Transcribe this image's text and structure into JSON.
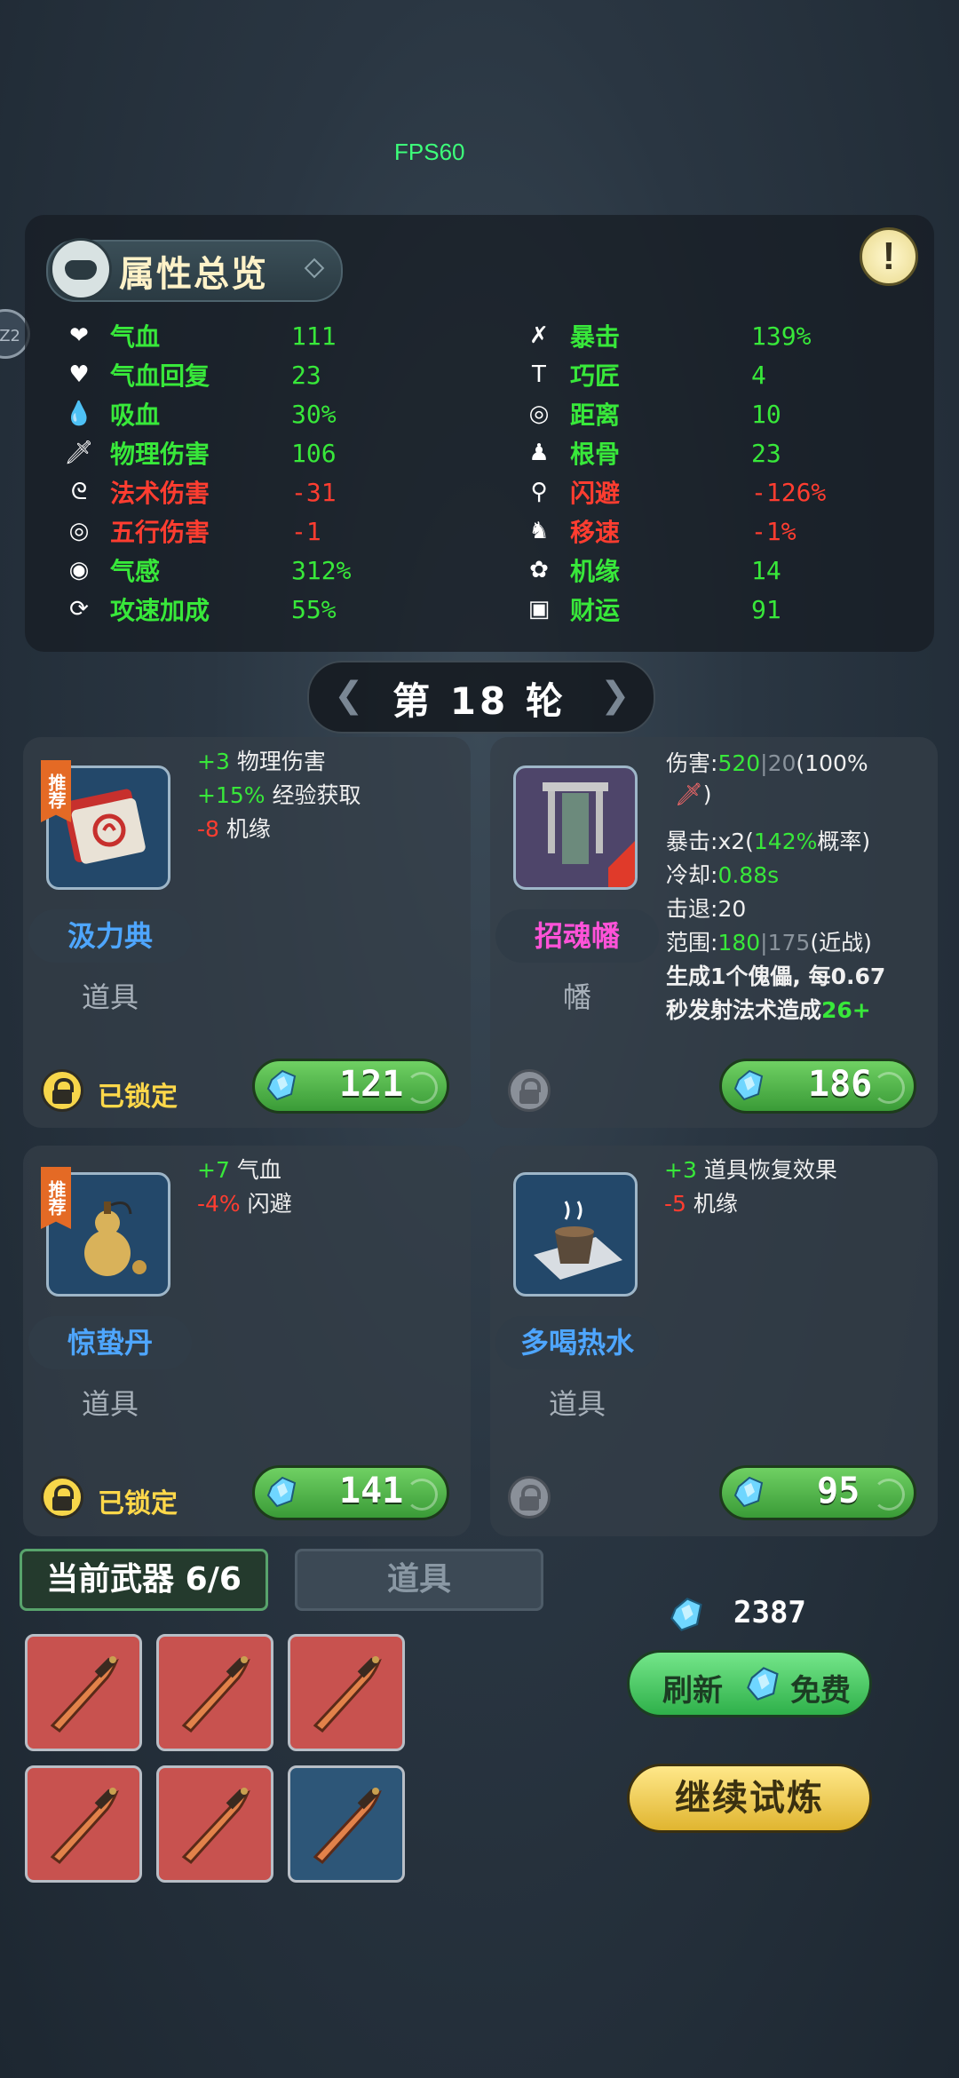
{
  "fps": "FPS60",
  "side_bubble": "Z2",
  "stats_panel": {
    "title": "属性总览",
    "alert_symbol": "!",
    "left": [
      {
        "icon": "heart-icon",
        "name": "气血",
        "value": "111",
        "color": "green"
      },
      {
        "icon": "heart-regen-icon",
        "name": "气血回复",
        "value": "23",
        "color": "green"
      },
      {
        "icon": "drop-icon",
        "name": "吸血",
        "value": "30%",
        "color": "green"
      },
      {
        "icon": "sword-icon",
        "name": "物理伤害",
        "value": "106",
        "color": "green"
      },
      {
        "icon": "spiral-icon",
        "name": "法术伤害",
        "value": "-31",
        "color": "red"
      },
      {
        "icon": "spiral-circle-icon",
        "name": "五行伤害",
        "value": "-1",
        "color": "red"
      },
      {
        "icon": "qi-icon",
        "name": "气感",
        "value": "312%",
        "color": "green"
      },
      {
        "icon": "attack-speed-icon",
        "name": "攻速加成",
        "value": "55%",
        "color": "green"
      }
    ],
    "right": [
      {
        "icon": "crit-icon",
        "name": "暴击",
        "value": "139%",
        "color": "green"
      },
      {
        "icon": "hammer-icon",
        "name": "巧匠",
        "value": "4",
        "color": "green"
      },
      {
        "icon": "target-icon",
        "name": "距离",
        "value": "10",
        "color": "green"
      },
      {
        "icon": "body-icon",
        "name": "根骨",
        "value": "23",
        "color": "green"
      },
      {
        "icon": "dodge-icon",
        "name": "闪避",
        "value": "-126%",
        "color": "red"
      },
      {
        "icon": "boot-icon",
        "name": "移速",
        "value": "-1%",
        "color": "red"
      },
      {
        "icon": "luck-icon",
        "name": "机缘",
        "value": "14",
        "color": "green"
      },
      {
        "icon": "coin-icon",
        "name": "财运",
        "value": "91",
        "color": "green"
      }
    ]
  },
  "round_label": "第 18 轮",
  "cards": [
    {
      "recommended": "推荐",
      "name": "汲力典",
      "type": "道具",
      "attrs": [
        {
          "prefix": "+3",
          "prefix_color": "green",
          "text": "物理伤害"
        },
        {
          "prefix": "+15%",
          "prefix_color": "green",
          "text": "经验获取"
        },
        {
          "prefix": "-8",
          "prefix_color": "red",
          "text": "机缘"
        }
      ],
      "locked": true,
      "lock_label": "已锁定",
      "price": "121"
    },
    {
      "name": "招魂幡",
      "type": "幡",
      "details": {
        "damage_label": "伤害:",
        "damage_val": "520",
        "damage_sep": "|",
        "damage_base": "20",
        "damage_extra": "(100%",
        "damage_close": ")",
        "crit_label": "暴击:",
        "crit_mult": "x2",
        "crit_open": "(",
        "crit_rate": "142%",
        "crit_rest": "概率)",
        "cooldown_label": "冷却:",
        "cooldown_val": "0.88s",
        "knockback_label": "击退:",
        "knockback_val": "20",
        "range_label": "范围:",
        "range_val": "180",
        "range_sep": "|",
        "range_base": "175",
        "range_note": "(近战)",
        "desc1": "生成1个傀儡, 每0.67",
        "desc2_a": "秒发射法术造成",
        "desc2_b": "26+"
      },
      "locked": false,
      "price": "186"
    },
    {
      "recommended": "推荐",
      "name": "惊蛰丹",
      "type": "道具",
      "attrs": [
        {
          "prefix": "+7",
          "prefix_color": "green",
          "text": "气血"
        },
        {
          "prefix": "-4%",
          "prefix_color": "red",
          "text": "闪避"
        }
      ],
      "locked": true,
      "lock_label": "已锁定",
      "price": "141"
    },
    {
      "name": "多喝热水",
      "type": "道具",
      "attrs": [
        {
          "prefix": "+3",
          "prefix_color": "green",
          "text": "道具恢复效果"
        },
        {
          "prefix": "-5",
          "prefix_color": "red",
          "text": "机缘"
        }
      ],
      "locked": false,
      "price": "95"
    }
  ],
  "tabs": {
    "weapons": "当前武器 6/6",
    "items": "道具"
  },
  "weapon_slots": [
    "red",
    "red",
    "red",
    "red",
    "red",
    "blue"
  ],
  "currency": "2387",
  "refresh": {
    "label": "刷新",
    "cost": "免费"
  },
  "continue_label": "继续试炼",
  "colors": {
    "green": "#38e83a",
    "red": "#ff3d30",
    "blue_name": "#4ea6ff",
    "pink_name": "#ff52d8",
    "gold": "#ffd84a"
  }
}
